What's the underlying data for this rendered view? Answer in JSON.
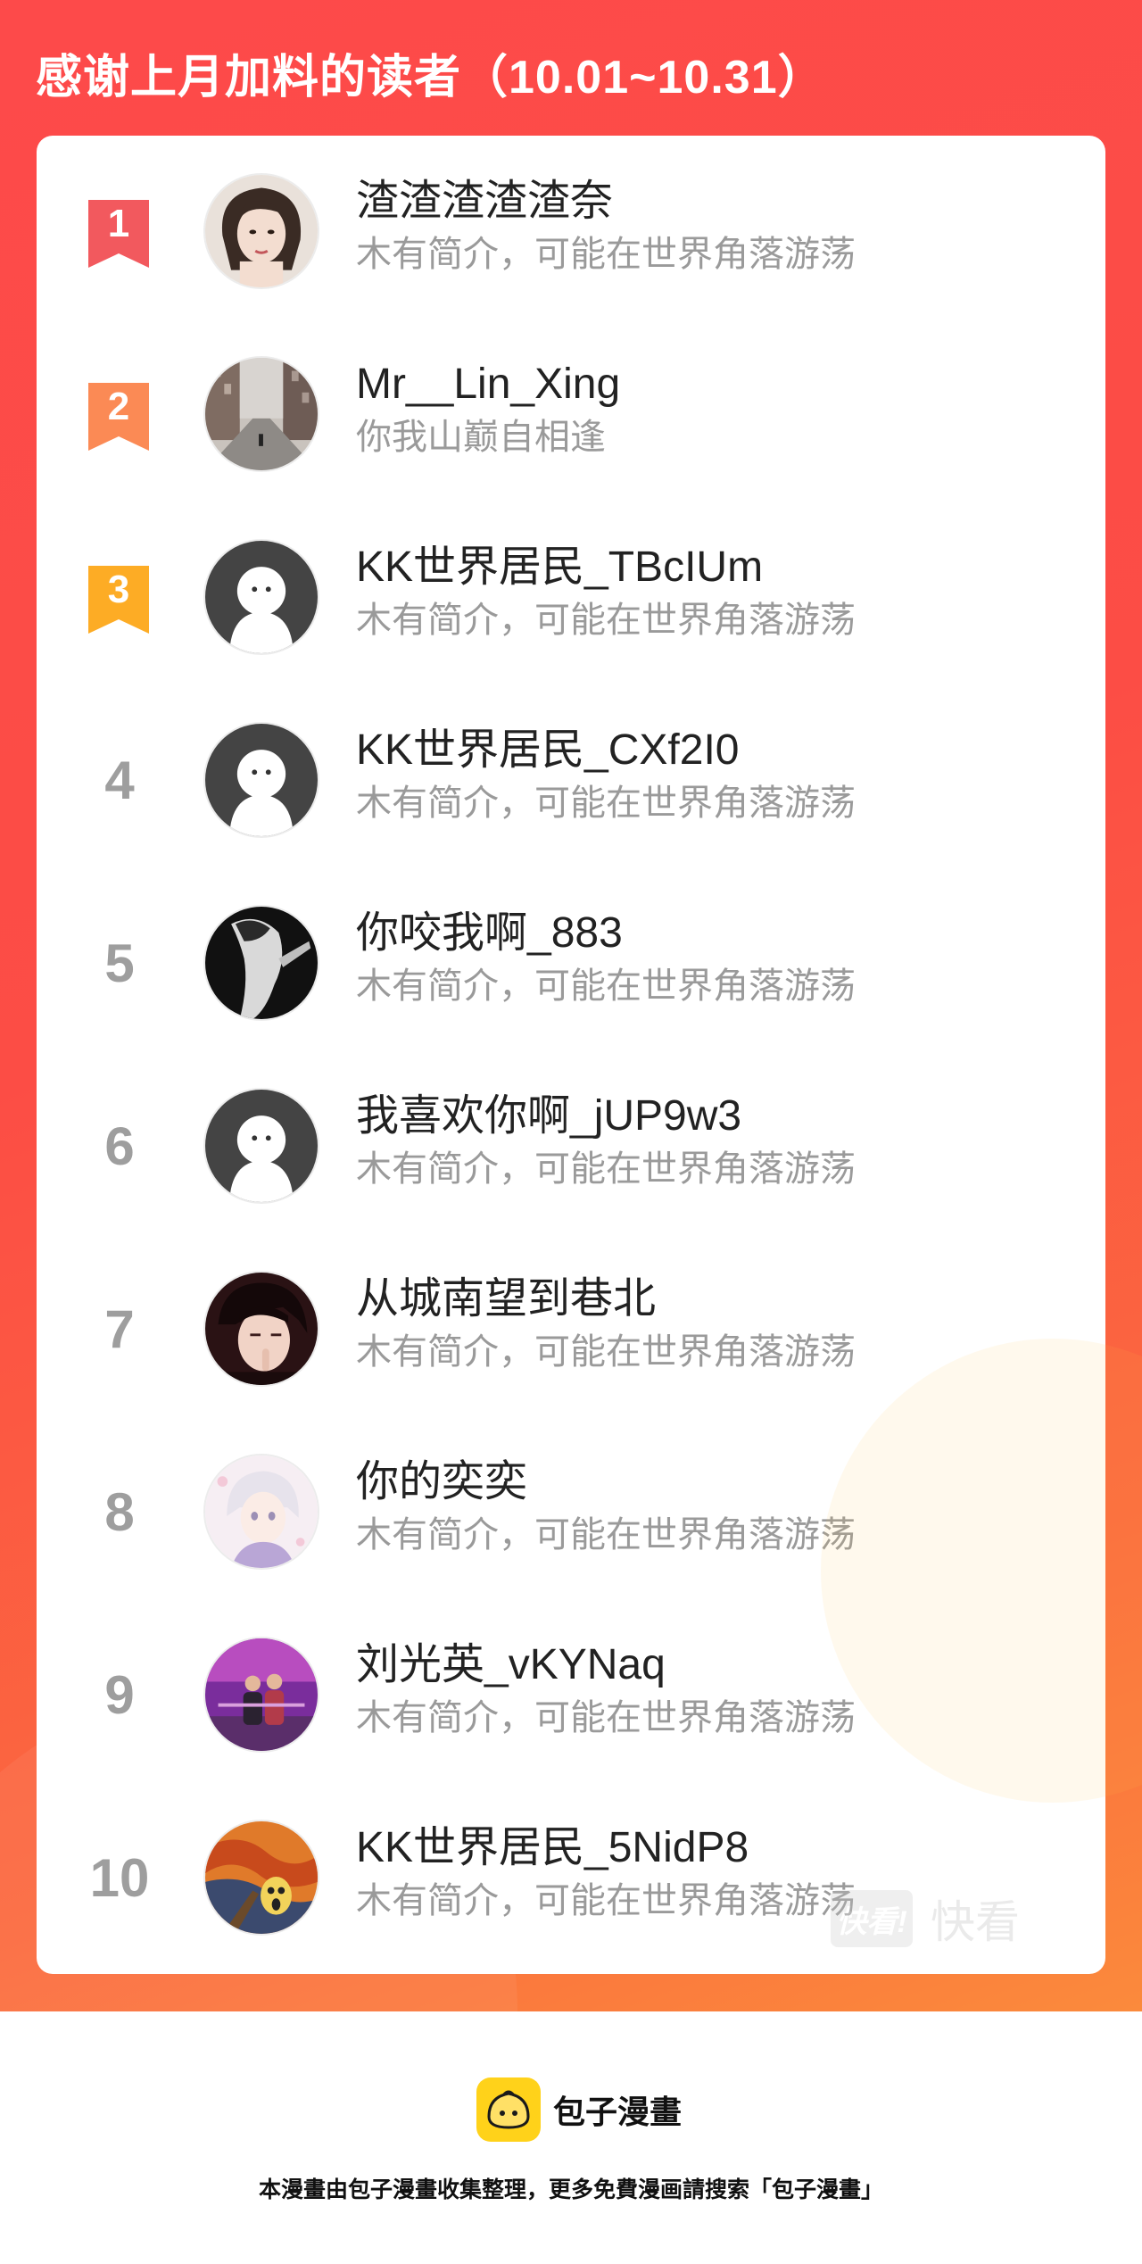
{
  "header": {
    "title": "感谢上月加料的读者（10.01~10.31）"
  },
  "colors": {
    "banner_start": "#fd4a4a",
    "banner_end": "#fb8a3c",
    "rank1_ribbon": "#f2595e",
    "rank2_ribbon": "#fb8a55",
    "rank3_ribbon": "#fdac25",
    "rank_gray": "#9e9e9e",
    "brand_yellow": "#ffd21a"
  },
  "readers": [
    {
      "rank": "1",
      "name": "渣渣渣渣渣奈",
      "bio": "木有简介，可能在世界角落游荡",
      "avatar": "girl-portrait-avatar"
    },
    {
      "rank": "2",
      "name": "Mr__Lin_Xing",
      "bio": "你我山巅自相逢",
      "avatar": "city-street-avatar"
    },
    {
      "rank": "3",
      "name": "KK世界居民_TBcIUm",
      "bio": "木有简介，可能在世界角落游荡",
      "avatar": "default-ghost-avatar"
    },
    {
      "rank": "4",
      "name": "KK世界居民_CXf2I0",
      "bio": "木有简介，可能在世界角落游荡",
      "avatar": "default-ghost-avatar"
    },
    {
      "rank": "5",
      "name": "你咬我啊_883",
      "bio": "木有简介，可能在世界角落游荡",
      "avatar": "dark-figure-avatar"
    },
    {
      "rank": "6",
      "name": "我喜欢你啊_jUP9w3",
      "bio": "木有简介，可能在世界角落游荡",
      "avatar": "default-ghost-avatar"
    },
    {
      "rank": "7",
      "name": "从城南望到巷北",
      "bio": "木有简介，可能在世界角落游荡",
      "avatar": "anime-boy-avatar"
    },
    {
      "rank": "8",
      "name": "你的奕奕",
      "bio": "木有简介，可能在世界角落游荡",
      "avatar": "anime-pastel-avatar"
    },
    {
      "rank": "9",
      "name": "刘光英_vKYNaq",
      "bio": "木有简介，可能在世界角落游荡",
      "avatar": "purple-photo-avatar"
    },
    {
      "rank": "10",
      "name": "KK世界居民_5NidP8",
      "bio": "木有简介，可能在世界角落游荡",
      "avatar": "scream-painting-avatar"
    }
  ],
  "watermark": {
    "badge": "快看!",
    "text": "快看"
  },
  "footer": {
    "brand_name": "包子漫畫",
    "note": "本漫畫由包子漫畫收集整理，更多免費漫画請搜索「包子漫畫」"
  }
}
